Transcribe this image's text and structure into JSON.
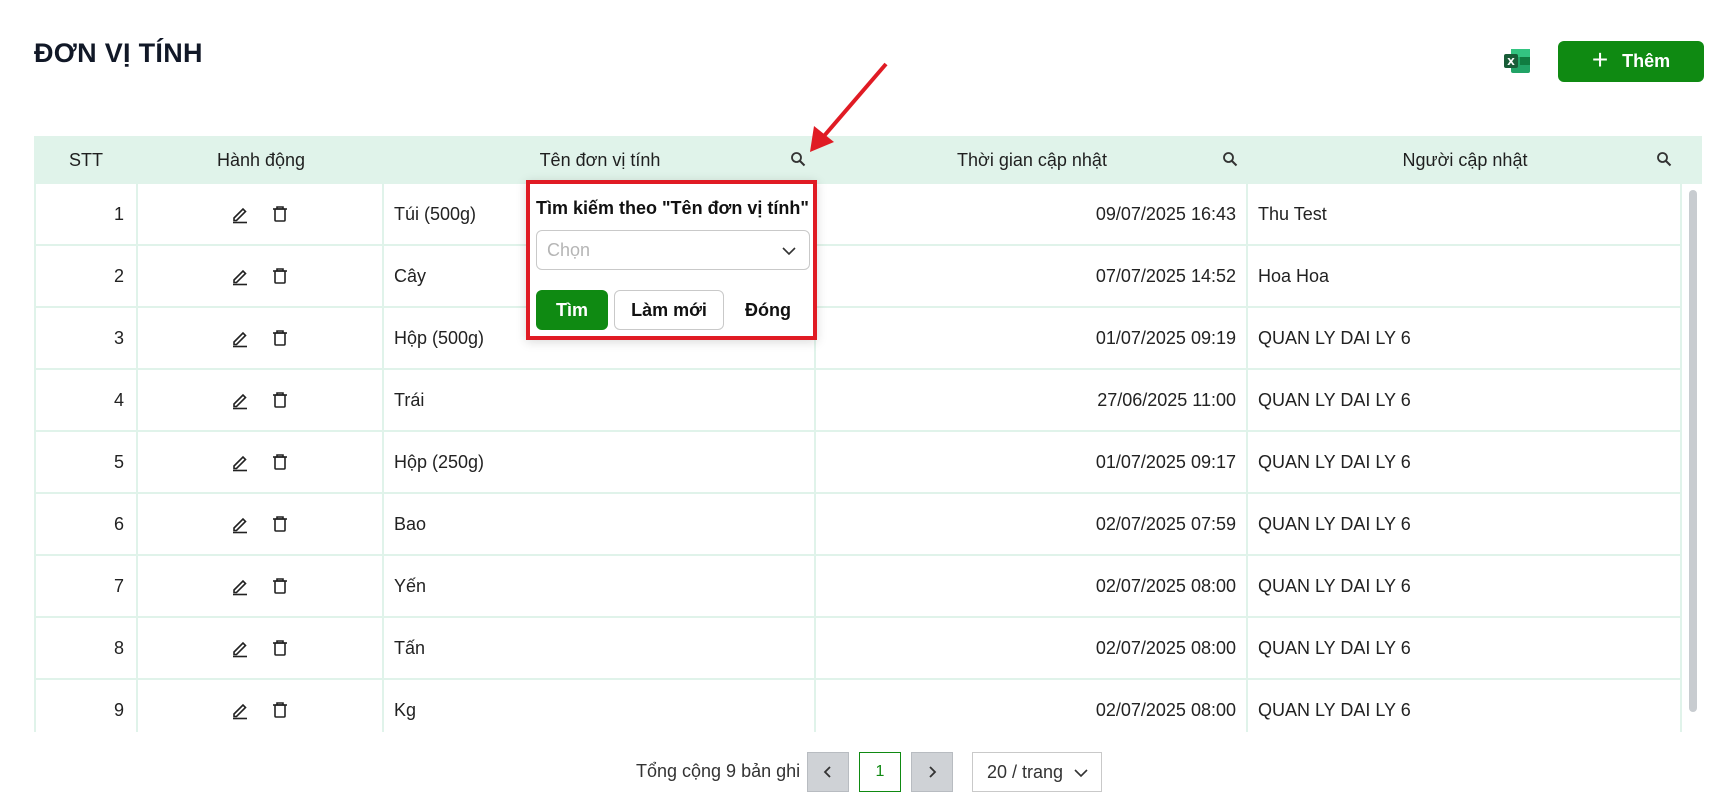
{
  "page": {
    "title": "ĐƠN VỊ TÍNH"
  },
  "toolbar": {
    "add_label": "Thêm",
    "excel_icon": "excel-icon",
    "add_icon": "plus-icon"
  },
  "table": {
    "columns": [
      "STT",
      "Hành động",
      "Tên đơn vị tính",
      "Thời gian cập nhật",
      "Người cập nhật"
    ],
    "rows": [
      {
        "stt": "1",
        "name": "Túi (500g)",
        "time": "09/07/2025 16:43",
        "user": "Thu Test"
      },
      {
        "stt": "2",
        "name": "Cây",
        "time": "07/07/2025 14:52",
        "user": "Hoa Hoa"
      },
      {
        "stt": "3",
        "name": "Hộp (500g)",
        "time": "01/07/2025 09:19",
        "user": "QUAN LY DAI LY 6"
      },
      {
        "stt": "4",
        "name": "Trái",
        "time": "27/06/2025 11:00",
        "user": "QUAN LY DAI LY 6"
      },
      {
        "stt": "5",
        "name": "Hộp (250g)",
        "time": "01/07/2025 09:17",
        "user": "QUAN LY DAI LY 6"
      },
      {
        "stt": "6",
        "name": "Bao",
        "time": "02/07/2025 07:59",
        "user": "QUAN LY DAI LY 6"
      },
      {
        "stt": "7",
        "name": "Yến",
        "time": "02/07/2025 08:00",
        "user": "QUAN LY DAI LY 6"
      },
      {
        "stt": "8",
        "name": "Tấn",
        "time": "02/07/2025 08:00",
        "user": "QUAN LY DAI LY 6"
      },
      {
        "stt": "9",
        "name": "Kg",
        "time": "02/07/2025 08:00",
        "user": "QUAN LY DAI LY 6"
      }
    ]
  },
  "search_popup": {
    "title": "Tìm kiếm theo \"Tên đơn vị tính\"",
    "placeholder": "Chọn",
    "find_label": "Tìm",
    "reset_label": "Làm mới",
    "close_label": "Đóng"
  },
  "pagination": {
    "total_text": "Tổng cộng 9 bản ghi",
    "current_page": "1",
    "page_size": "20 / trang"
  },
  "colors": {
    "primary": "#0f8a12",
    "header_bg": "#e0f3ea",
    "highlight": "#e01b24"
  }
}
